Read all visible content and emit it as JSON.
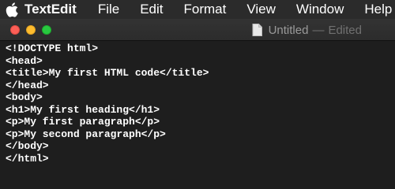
{
  "menubar": {
    "apple_icon": "apple-logo-icon",
    "items": [
      "TextEdit",
      "File",
      "Edit",
      "Format",
      "View",
      "Window",
      "Help"
    ]
  },
  "window": {
    "title": "Untitled",
    "separator": "—",
    "status": "Edited",
    "doc_icon": "document-icon"
  },
  "editor": {
    "lines": [
      "<!DOCTYPE html>",
      "<head>",
      "<title>My first HTML code</title>",
      "</head>",
      "<body>",
      "<h1>My first heading</h1>",
      "<p>My first paragraph</p>",
      "<p>My second paragraph</p>",
      "</body>",
      "</html>"
    ]
  },
  "colors": {
    "close": "#fc5f57",
    "minimize": "#fdbc2e",
    "maximize": "#28c840",
    "editor_bg": "#1e1e1e",
    "text": "#ffffff"
  }
}
